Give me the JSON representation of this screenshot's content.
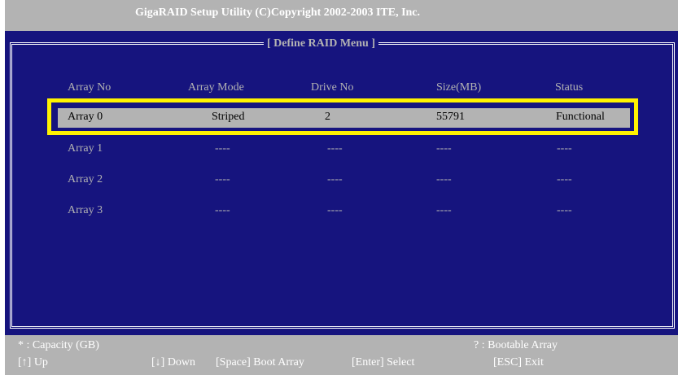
{
  "title": "GigaRAID Setup Utility (C)Copyright 2002-2003 ITE, Inc.",
  "menu_title": "[  Define RAID Menu  ]",
  "columns": [
    "Array No",
    "Array Mode",
    "Drive No",
    "Size(MB)",
    "Status"
  ],
  "rows": [
    {
      "array": "Array  0",
      "mode": "Striped",
      "drive": "2",
      "size": "55791",
      "status": "Functional"
    },
    {
      "array": "Array  1",
      "mode": "----",
      "drive": "----",
      "size": "----",
      "status": "----"
    },
    {
      "array": "Array  2",
      "mode": "----",
      "drive": "----",
      "size": "----",
      "status": "----"
    },
    {
      "array": "Array  3",
      "mode": "----",
      "drive": "----",
      "size": "----",
      "status": "----"
    }
  ],
  "footer": {
    "capacity": "* : Capacity (GB)",
    "bootable": "?    : Bootable Array",
    "up": "[↑] Up",
    "down": "[↓]  Down",
    "boot": "[Space] Boot Array",
    "select": "[Enter] Select",
    "exit": "[ESC] Exit"
  },
  "colors": {
    "background": "#16147e",
    "bar": "#b3b3b3",
    "highlight_box": "#fff200"
  }
}
